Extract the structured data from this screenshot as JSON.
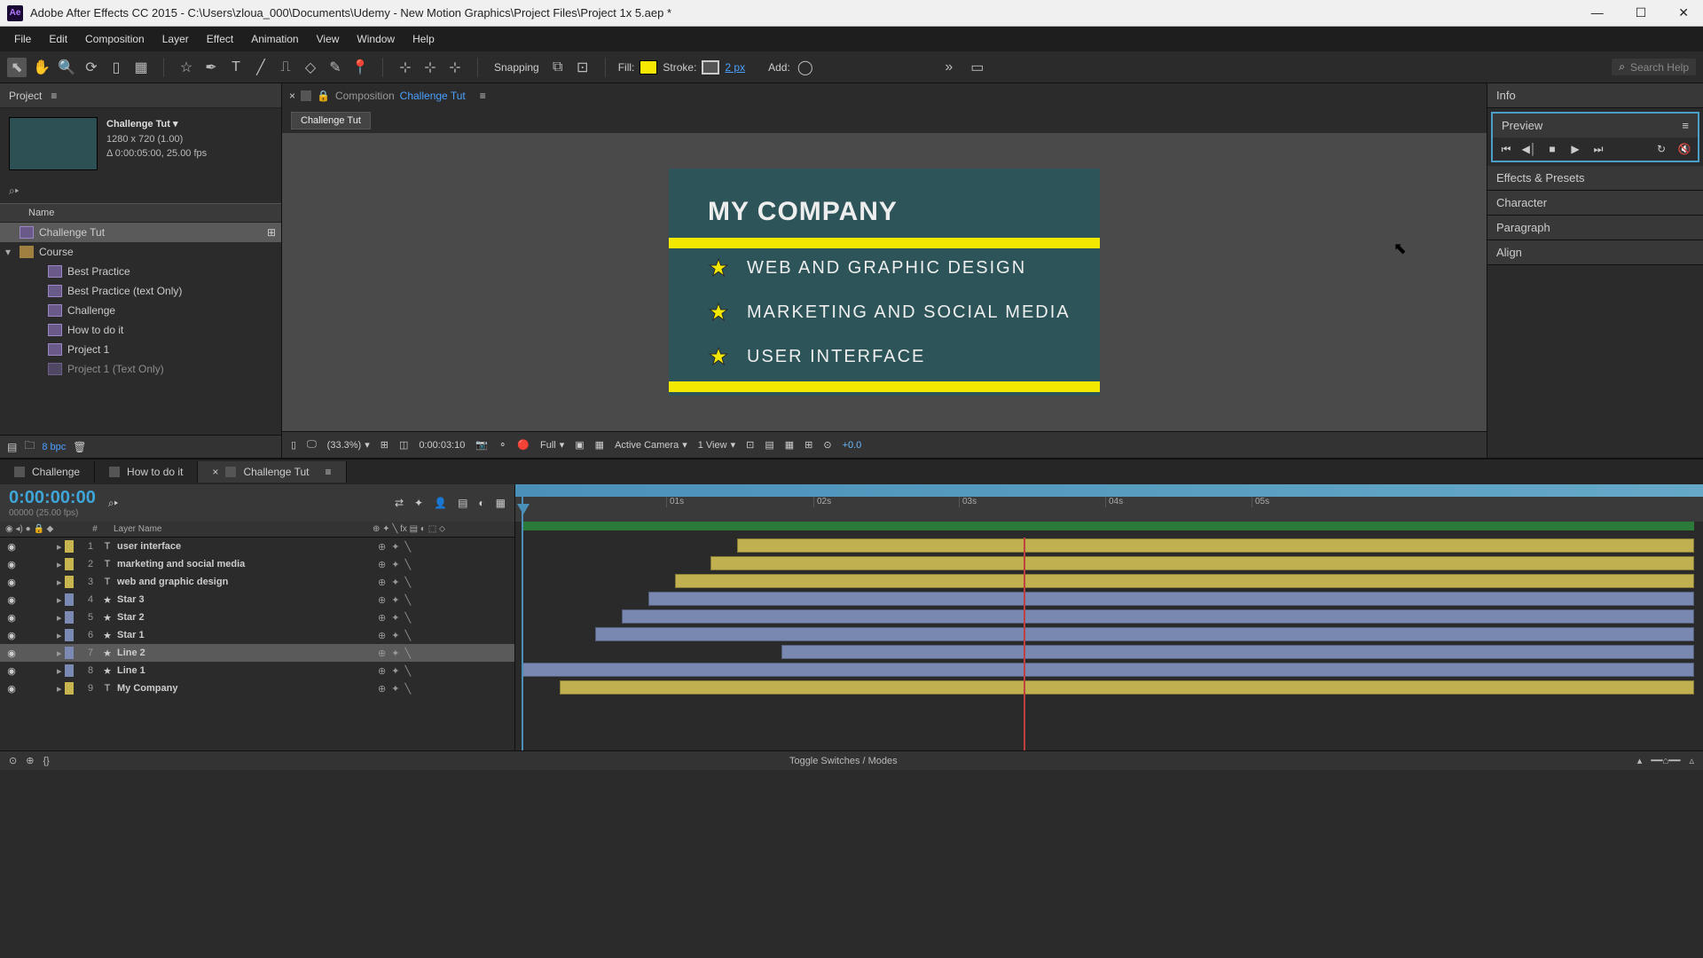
{
  "title": "Adobe After Effects CC 2015 - C:\\Users\\zloua_000\\Documents\\Udemy - New Motion Graphics\\Project Files\\Project 1x 5.aep *",
  "menu": [
    "File",
    "Edit",
    "Composition",
    "Layer",
    "Effect",
    "Animation",
    "View",
    "Window",
    "Help"
  ],
  "toolbar": {
    "snapping": "Snapping",
    "fill": "Fill:",
    "stroke": "Stroke:",
    "px": "2 px",
    "add": "Add:",
    "search_placeholder": "Search Help"
  },
  "project": {
    "panel_label": "Project",
    "comp_name": "Challenge Tut",
    "dims": "1280 x 720 (1.00)",
    "duration": "Δ 0:00:05:00, 25.00 fps",
    "name_col": "Name",
    "tree": {
      "root": "Challenge Tut",
      "folder": "Course",
      "items": [
        "Best Practice",
        "Best Practice (text Only)",
        "Challenge",
        "How to do it",
        "Project 1",
        "Project 1 (Text Only)"
      ]
    },
    "bpc": "8 bpc"
  },
  "composition": {
    "prefix": "Composition",
    "name": "Challenge Tut",
    "crumb": "Challenge Tut",
    "canvas": {
      "title": "MY COMPANY",
      "b1": "WEB AND GRAPHIC DESIGN",
      "b2": "MARKETING AND SOCIAL MEDIA",
      "b3": "USER INTERFACE"
    },
    "footer": {
      "zoom": "(33.3%)",
      "time": "0:00:03:10",
      "res": "Full",
      "camera": "Active Camera",
      "view": "1 View",
      "exposure": "+0.0"
    }
  },
  "right": {
    "info": "Info",
    "preview": "Preview",
    "effects": "Effects & Presets",
    "character": "Character",
    "paragraph": "Paragraph",
    "align": "Align"
  },
  "timeline": {
    "tabs": [
      "Challenge",
      "How to do it",
      "Challenge Tut"
    ],
    "timecode": "0:00:00:00",
    "timecode_sub": "00000 (25.00 fps)",
    "cols": {
      "num": "#",
      "name": "Layer Name"
    },
    "layers": [
      {
        "n": "1",
        "name": "user interface",
        "color": "y",
        "type": "T"
      },
      {
        "n": "2",
        "name": "marketing and social media",
        "color": "y",
        "type": "T"
      },
      {
        "n": "3",
        "name": "web and graphic design",
        "color": "y",
        "type": "T"
      },
      {
        "n": "4",
        "name": "Star 3",
        "color": "b",
        "type": "★"
      },
      {
        "n": "5",
        "name": "Star 2",
        "color": "b",
        "type": "★"
      },
      {
        "n": "6",
        "name": "Star 1",
        "color": "b",
        "type": "★"
      },
      {
        "n": "7",
        "name": "Line 2",
        "color": "b",
        "type": "★",
        "sel": true
      },
      {
        "n": "8",
        "name": "Line 1",
        "color": "b",
        "type": "★"
      },
      {
        "n": "9",
        "name": "My Company",
        "color": "y",
        "type": "T"
      }
    ],
    "ruler": [
      "01s",
      "02s",
      "03s",
      "04s",
      "05s"
    ],
    "toggle": "Toggle Switches / Modes"
  }
}
